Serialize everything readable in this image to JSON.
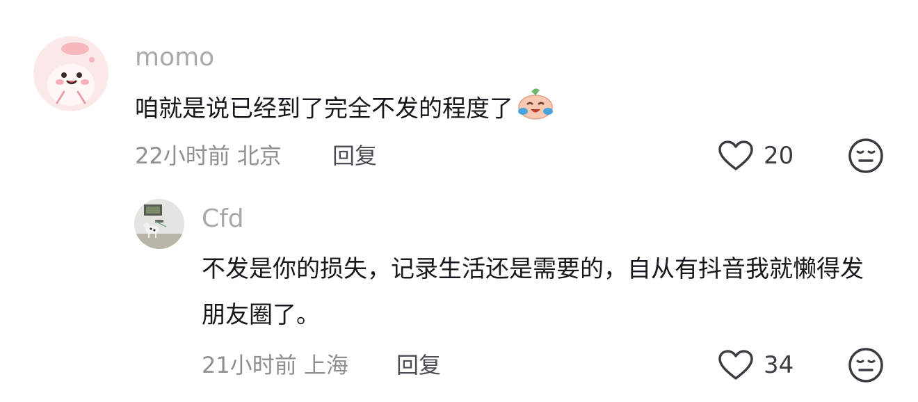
{
  "comments": [
    {
      "username": "momo",
      "text": "咱就是说已经到了完全不发的程度了",
      "emoji": "crying-laughing-emoji",
      "time": "22小时前",
      "location": "北京",
      "reply_label": "回复",
      "likes": "20"
    },
    {
      "username": "Cfd",
      "text": "不发是你的损失，记录生活还是需要的，自从有抖音我就懒得发朋友圈了。",
      "time": "21小时前",
      "location": "上海",
      "reply_label": "回复",
      "likes": "34"
    }
  ],
  "icons": {
    "like": "heart-outline-icon",
    "dislike": "meh-face-icon"
  },
  "colors": {
    "username": "#a8a8ad",
    "text": "#16181d",
    "meta": "#8e8e93",
    "icon": "#3a3c42"
  }
}
